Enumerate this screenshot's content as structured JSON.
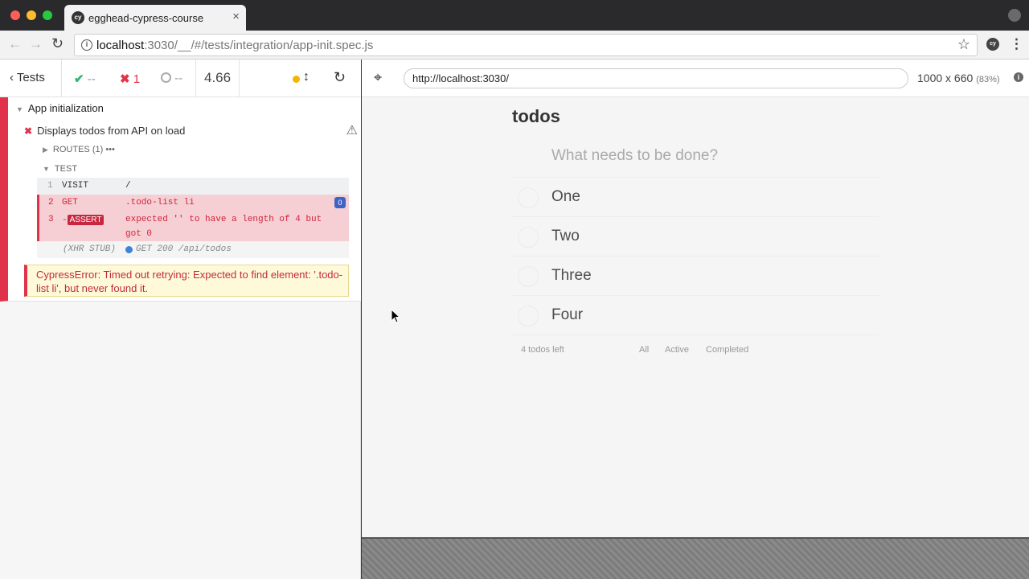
{
  "browser": {
    "tab_title": "egghead-cypress-course",
    "tab_favicon_text": "cy",
    "url_host": "localhost",
    "url_rest": ":3030/__/#/tests/integration/app-init.spec.js",
    "ext_icon_text": "cy"
  },
  "reporter": {
    "header": {
      "tests_label": "Tests",
      "passed": "--",
      "failed": "1",
      "pending": "--",
      "duration": "4.66"
    },
    "suite_title": "App initialization",
    "test_title": "Displays todos from API on load",
    "routes_label": "ROUTES (1)",
    "test_label": "TEST",
    "commands": [
      {
        "num": "1",
        "name": "VISIT",
        "message": "/"
      },
      {
        "num": "2",
        "name": "GET",
        "message": ".todo-list li",
        "badge": "0"
      },
      {
        "num": "3",
        "name": "ASSERT",
        "message": "expected '' to have a length of 4 but got 0"
      }
    ],
    "stub": {
      "label": "(XHR STUB)",
      "message": "GET 200 /api/todos"
    },
    "error": "CypressError: Timed out retrying: Expected to find element: '.todo-list li', but never found it."
  },
  "aut": {
    "url": "http://localhost:3030/",
    "viewport": "1000 x 660",
    "viewport_pct": "(83%)"
  },
  "todo_app": {
    "title": "todos",
    "new_todo_placeholder": "What needs to be done?",
    "items": [
      {
        "label": "One"
      },
      {
        "label": "Two"
      },
      {
        "label": "Three"
      },
      {
        "label": "Four"
      }
    ],
    "footer": {
      "count": "4 todos left",
      "filter_all": "All",
      "filter_active": "Active",
      "filter_completed": "Completed"
    }
  },
  "colors": {
    "fail_red": "#e0334a",
    "pass_green": "#2fb36f",
    "stub_blue": "#3f83d6",
    "error_bg": "#fefad9"
  }
}
